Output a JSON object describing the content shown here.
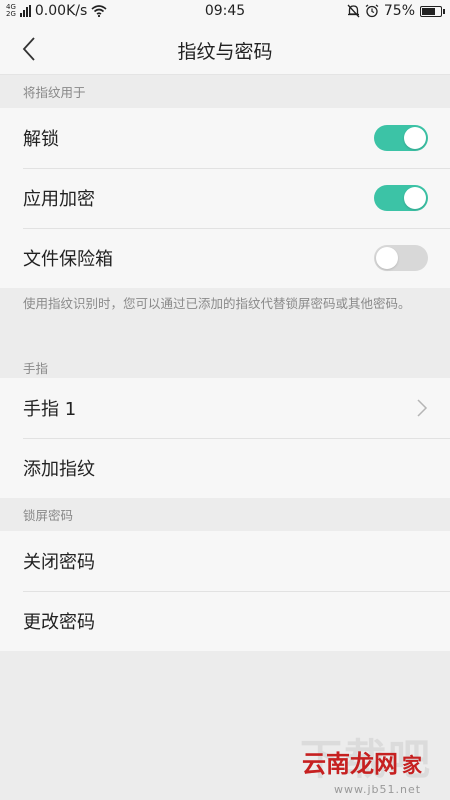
{
  "status_bar": {
    "network_top": "4G",
    "network_bottom": "2G",
    "speed": "0.00K/s",
    "time": "09:45",
    "battery": "75%",
    "battery_level": 0.75
  },
  "header": {
    "title": "指纹与密码"
  },
  "section_use": {
    "label": "将指纹用于",
    "items": [
      {
        "label": "解锁",
        "enabled": true
      },
      {
        "label": "应用加密",
        "enabled": true
      },
      {
        "label": "文件保险箱",
        "enabled": false
      }
    ],
    "note": "使用指纹识别时，您可以通过已添加的指纹代替锁屏密码或其他密码。"
  },
  "section_finger": {
    "label": "手指",
    "items": [
      {
        "label": "手指 1"
      },
      {
        "label": "添加指纹"
      }
    ]
  },
  "section_lock": {
    "label": "锁屏密码",
    "items": [
      {
        "label": "关闭密码"
      },
      {
        "label": "更改密码"
      }
    ]
  },
  "watermark": {
    "big": "下载吧",
    "red": "云南龙网",
    "jia": "家",
    "url": "www.jb51.net"
  },
  "colors": {
    "toggle_on": "#3cc3a6",
    "toggle_off": "#d8d8d8"
  }
}
